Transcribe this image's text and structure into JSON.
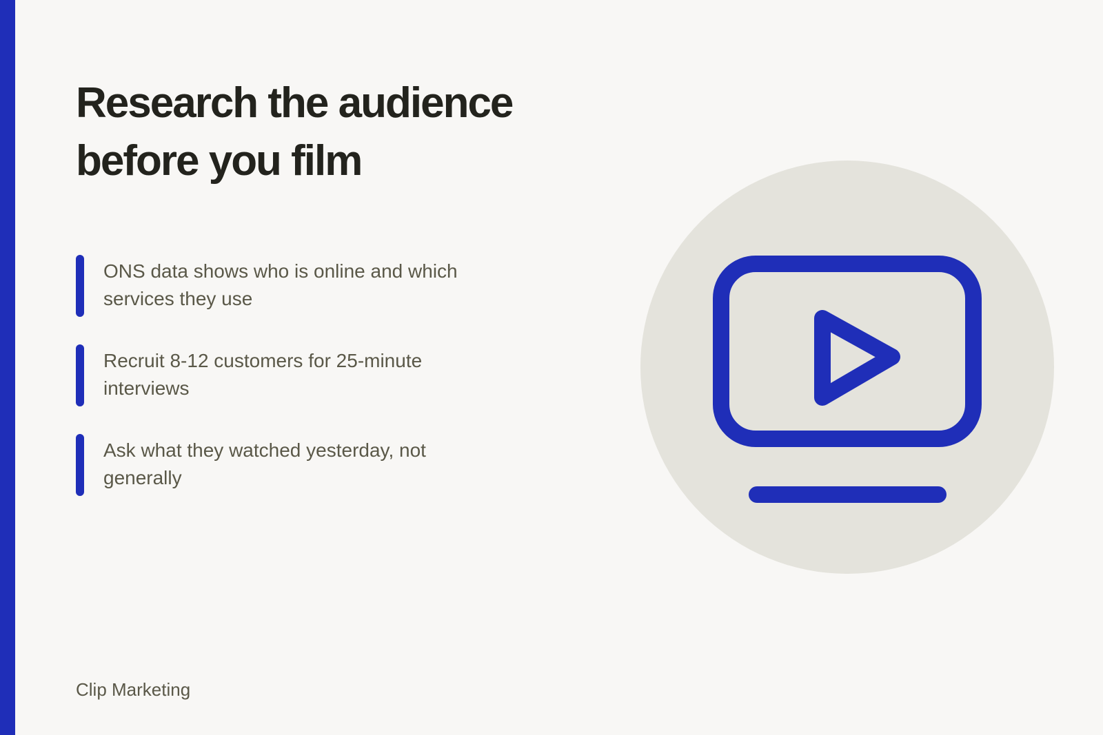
{
  "slide": {
    "title": "Research the audience before you film",
    "bullets": [
      {
        "text": "ONS data shows who is online and which services they use"
      },
      {
        "text": "Recruit 8-12 customers for 25-minute interviews"
      },
      {
        "text": "Ask what they watched yesterday, not generally"
      }
    ],
    "footer": "Clip Marketing",
    "illustration_icon": "video-play-icon"
  },
  "colors": {
    "accent": "#1f2eb8",
    "background": "#f8f7f5",
    "circle": "#e4e3dc",
    "title": "#23231d",
    "body_text": "#5a5848"
  }
}
